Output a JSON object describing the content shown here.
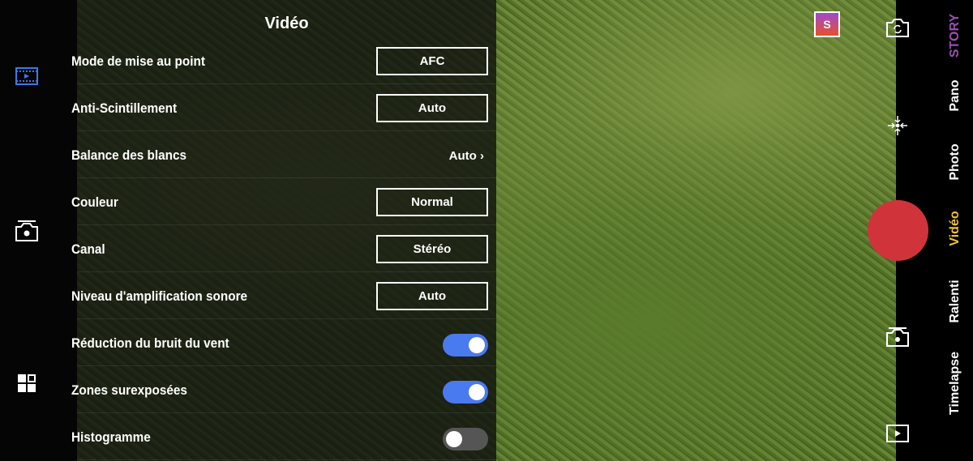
{
  "panel": {
    "title": "Vidéo",
    "rows": [
      {
        "label": "Mode de mise au point",
        "type": "button",
        "value": "AFC"
      },
      {
        "label": "Anti-Scintillement",
        "type": "button",
        "value": "Auto"
      },
      {
        "label": "Balance des blancs",
        "type": "link",
        "value": "Auto"
      },
      {
        "label": "Couleur",
        "type": "button",
        "value": "Normal"
      },
      {
        "label": "Canal",
        "type": "button",
        "value": "Stéréo"
      },
      {
        "label": "Niveau d'amplification sonore",
        "type": "button",
        "value": "Auto"
      },
      {
        "label": "Réduction du bruit du vent",
        "type": "toggle",
        "on": true
      },
      {
        "label": "Zones surexposées",
        "type": "toggle",
        "on": true
      },
      {
        "label": "Histogramme",
        "type": "toggle",
        "on": false
      }
    ]
  },
  "story_badge": "S",
  "modes": [
    {
      "label": "STORY",
      "color": "#9a4fb0"
    },
    {
      "label": "Pano"
    },
    {
      "label": "Photo"
    },
    {
      "label": "Vidéo",
      "active": true,
      "color": "#f2c230"
    },
    {
      "label": "Ralenti"
    },
    {
      "label": "Timelapse"
    }
  ],
  "colors": {
    "accent": "#4a7af0",
    "record": "#d0343a",
    "active_mode": "#f2c230"
  }
}
